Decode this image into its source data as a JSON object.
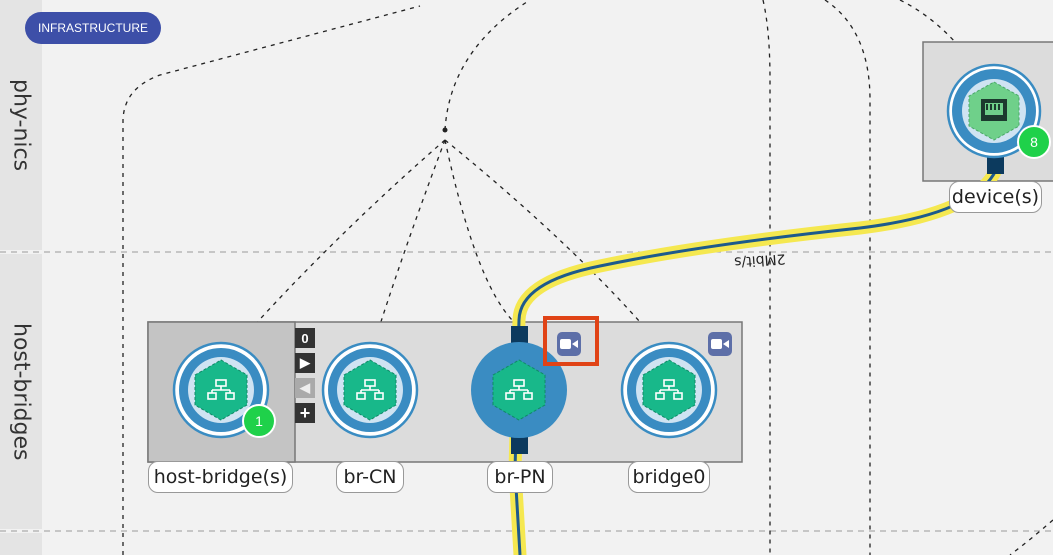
{
  "header": {
    "badge_label": "INFRASTRUCTURE"
  },
  "lanes": [
    {
      "label": "phy-nics"
    },
    {
      "label": "host-bridges"
    }
  ],
  "nodes": {
    "device": {
      "label": "device(s)",
      "count": "8",
      "icon": "ethernet-port-icon"
    },
    "host_bridge": {
      "label": "host-bridge(s)",
      "count": "1",
      "icon": "network-hub-icon"
    },
    "br_cn": {
      "label": "br-CN",
      "icon": "network-hub-icon"
    },
    "br_pn": {
      "label": "br-PN",
      "icon": "network-hub-icon"
    },
    "bridge0": {
      "label": "bridge0",
      "icon": "network-hub-icon"
    }
  },
  "group_controls": {
    "count": "0",
    "next_icon": "play-right-icon",
    "prev_icon": "play-left-icon",
    "add_icon": "plus-icon"
  },
  "link": {
    "rate_label": "2Mbit/s"
  },
  "colors": {
    "accent": "#3d4fa8",
    "node_ring": "#3a8cc2",
    "node_core": "#18b88a",
    "count_badge": "#1fd14a",
    "link_glow": "#f5e850",
    "link_line": "#1d5a8c",
    "highlight": "#e04316"
  }
}
